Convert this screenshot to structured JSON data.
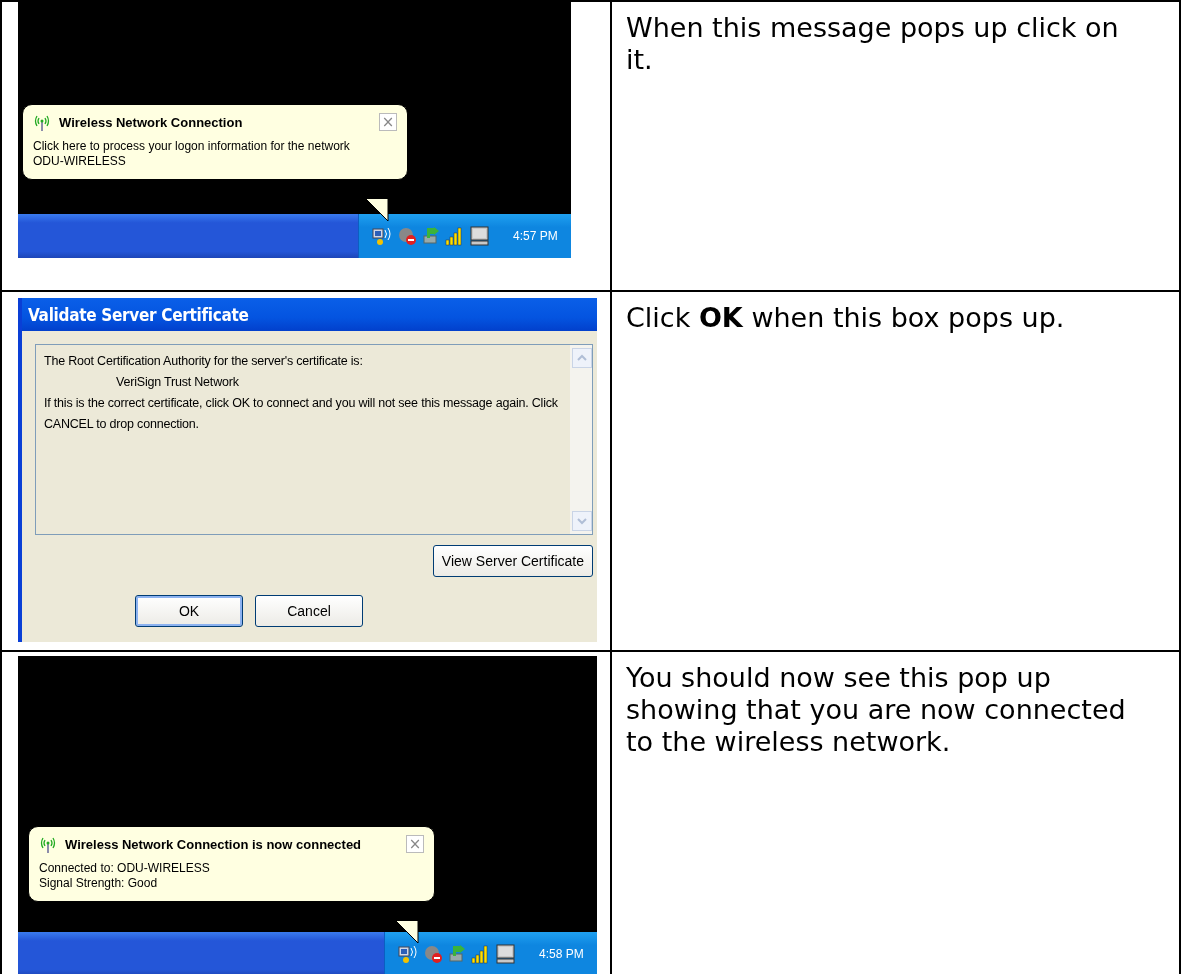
{
  "steps": [
    {
      "kind": "balloon",
      "balloon": {
        "title": "Wireless Network Connection",
        "close": "×",
        "lines": [
          "Click here to process your logon information for the network",
          "ODU-WIRELESS"
        ]
      },
      "clock": "4:57 PM",
      "instruction": "When this message pops up click on it."
    },
    {
      "kind": "dialog",
      "dialog": {
        "title": "Validate Server Certificate",
        "lines": [
          {
            "text": "The Root Certification Authority for the server's certificate is:",
            "indent": false
          },
          {
            "text": "VeriSign Trust Network",
            "indent": true
          },
          {
            "text": "If this is the correct certificate, click OK to connect and you will not see this message again.  Click CANCEL to drop connection.",
            "indent": false
          }
        ],
        "view_button": "View Server Certificate",
        "ok_button": "OK",
        "cancel_button": "Cancel"
      },
      "instruction": "Click **OK** when this box pops up."
    },
    {
      "kind": "balloon",
      "balloon": {
        "title": "Wireless Network Connection is now connected",
        "close": "×",
        "lines": [
          "Connected to: ODU-WIRELESS",
          "Signal Strength: Good"
        ]
      },
      "clock": "4:58 PM",
      "instruction": "You should now see this pop up showing that you are now connected to the wireless network."
    }
  ]
}
